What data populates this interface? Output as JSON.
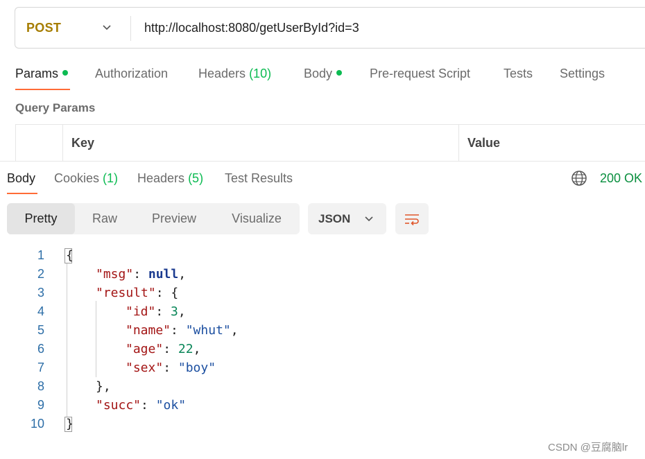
{
  "request": {
    "method": "POST",
    "url": "http://localhost:8080/getUserById?id=3"
  },
  "request_tabs": [
    {
      "label": "Params",
      "count": "",
      "dot": true
    },
    {
      "label": "Authorization",
      "count": "",
      "dot": false
    },
    {
      "label": "Headers",
      "count": "(10)",
      "dot": false
    },
    {
      "label": "Body",
      "count": "",
      "dot": true
    },
    {
      "label": "Pre-request Script",
      "count": "",
      "dot": false
    },
    {
      "label": "Tests",
      "count": "",
      "dot": false
    },
    {
      "label": "Settings",
      "count": "",
      "dot": false
    }
  ],
  "query_params": {
    "title": "Query Params",
    "col_key": "Key",
    "col_value": "Value"
  },
  "response_tabs": [
    {
      "label": "Body",
      "count": ""
    },
    {
      "label": "Cookies",
      "count": "(1)"
    },
    {
      "label": "Headers",
      "count": "(5)"
    },
    {
      "label": "Test Results",
      "count": ""
    }
  ],
  "status": "200 OK",
  "view_modes": [
    "Pretty",
    "Raw",
    "Preview",
    "Visualize"
  ],
  "format": "JSON",
  "code_lines": [
    "1",
    "2",
    "3",
    "4",
    "5",
    "6",
    "7",
    "8",
    "9",
    "10"
  ],
  "json": {
    "msg_key": "\"msg\"",
    "msg_val": "null",
    "result_key": "\"result\"",
    "id_key": "\"id\"",
    "id_val": "3",
    "name_key": "\"name\"",
    "name_val": "\"whut\"",
    "age_key": "\"age\"",
    "age_val": "22",
    "sex_key": "\"sex\"",
    "sex_val": "\"boy\"",
    "succ_key": "\"succ\"",
    "succ_val": "\"ok\""
  },
  "watermark": "CSDN @豆腐脑lr",
  "colors": {
    "accent": "#ff6c37",
    "method": "#a67d00",
    "success": "#0cbb52"
  },
  "icons": [
    "chevron-down-icon",
    "globe-icon",
    "wrap-lines-icon"
  ]
}
